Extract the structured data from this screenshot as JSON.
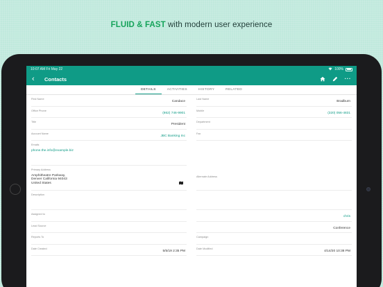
{
  "headline": {
    "accent": "FLUID & FAST",
    "rest": "with modern user experience"
  },
  "status": {
    "time": "10:07 AM",
    "date": "Fri May 22",
    "battery": "100%"
  },
  "nav": {
    "back": "‹",
    "title": "Contacts",
    "icons": [
      "home-icon",
      "pencil-icon",
      "more-icon"
    ],
    "more": "···"
  },
  "tabs": [
    "DETAILS",
    "ACTIVITIES",
    "HISTORY",
    "RELATED"
  ],
  "fields": {
    "first_name": {
      "label": "First Name",
      "value": "Candace"
    },
    "last_name": {
      "label": "Last Name",
      "value": "Bradburn"
    },
    "office_phone": {
      "label": "Office Phone",
      "value": "(862) 746-9901"
    },
    "mobile": {
      "label": "Mobile",
      "value": "(320) 056-4831"
    },
    "title": {
      "label": "Title",
      "value": "President"
    },
    "department": {
      "label": "Department",
      "value": ""
    },
    "account_name": {
      "label": "Account Name",
      "value": "JBC Banking Inc"
    },
    "fax": {
      "label": "Fax",
      "value": ""
    },
    "email": {
      "label": "Emails",
      "value": "phone.the.info@example.biz"
    },
    "primary_address": {
      "label": "Primary Address",
      "line1": "Amphitheatre Parkway,",
      "line2": "Denver California 94043",
      "line3": "United States"
    },
    "alternate_address": {
      "label": "Alternate Address",
      "value": ""
    },
    "description": {
      "label": "Description",
      "value": ""
    },
    "assigned_to": {
      "label": "Assigned to",
      "value": "chris"
    },
    "lead_source": {
      "label": "Lead Source",
      "value": "Conference"
    },
    "reports_to": {
      "label": "Reports To",
      "value": ""
    },
    "campaign": {
      "label": "Campaign",
      "value": ""
    },
    "date_created": {
      "label": "Date Created",
      "value": "5/5/19 2:35 PM"
    },
    "date_modified": {
      "label": "Date Modified",
      "value": "4/14/20 10:38 PM"
    }
  },
  "colors": {
    "accent": "#0f9b86",
    "headline_accent": "#16a35a",
    "background": "#bfe9dc"
  }
}
